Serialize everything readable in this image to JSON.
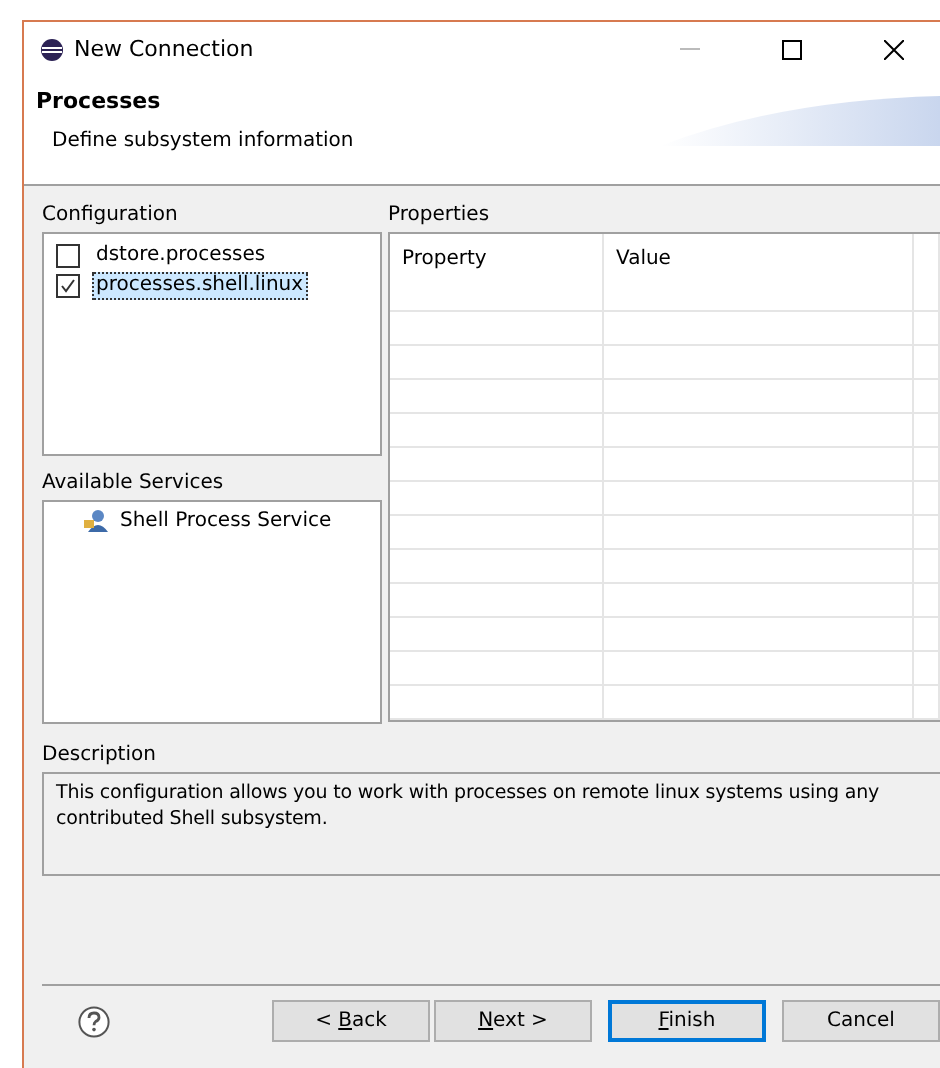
{
  "window": {
    "title": "New Connection"
  },
  "header": {
    "title": "Processes",
    "subtitle": "Define subsystem information"
  },
  "configuration": {
    "label": "Configuration",
    "items": [
      {
        "label": "dstore.processes",
        "checked": false,
        "selected": false
      },
      {
        "label": "processes.shell.linux",
        "checked": true,
        "selected": true
      }
    ]
  },
  "available_services": {
    "label": "Available Services",
    "items": [
      {
        "label": "Shell Process Service"
      }
    ]
  },
  "properties": {
    "label": "Properties",
    "columns": [
      "Property",
      "Value"
    ]
  },
  "description": {
    "label": "Description",
    "text": "This configuration allows you to work with processes on remote linux systems using any contributed Shell subsystem."
  },
  "buttons": [
    {
      "before": "< ",
      "key": "B",
      "after": "ack",
      "default": false
    },
    {
      "key": "N",
      "after": "ext >",
      "default": false
    },
    {
      "key": "F",
      "after": "inish",
      "default": true
    },
    {
      "before": "Cancel",
      "default": false
    }
  ]
}
